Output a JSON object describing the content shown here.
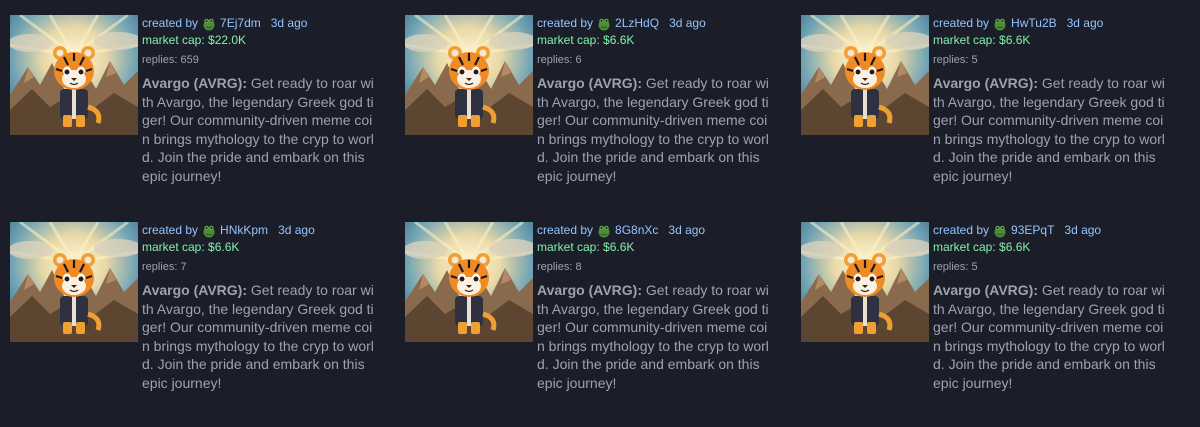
{
  "cards": [
    {
      "created_label": "created by",
      "creator": "7Ej7dm",
      "time": "3d ago",
      "market_cap": "market cap: $22.0K",
      "replies": "replies: 659",
      "token_name": "Avargo (AVRG):",
      "description": " Get ready to roar with Avargo, the legendary Greek god tiger! Our community-driven meme coin brings mythology to the cryp to world. Join the pride and embark on this epic journey!"
    },
    {
      "created_label": "created by",
      "creator": "2LzHdQ",
      "time": "3d ago",
      "market_cap": "market cap: $6.6K",
      "replies": "replies: 6",
      "token_name": "Avargo (AVRG):",
      "description": " Get ready to roar with Avargo, the legendary Greek god tiger! Our community-driven meme coin brings mythology to the cryp to world. Join the pride and embark on this epic journey!"
    },
    {
      "created_label": "created by",
      "creator": "HwTu2B",
      "time": "3d ago",
      "market_cap": "market cap: $6.6K",
      "replies": "replies: 5",
      "token_name": "Avargo (AVRG):",
      "description": " Get ready to roar with Avargo, the legendary Greek god tiger! Our community-driven meme coin brings mythology to the cryp to world. Join the pride and embark on this epic journey!"
    },
    {
      "created_label": "created by",
      "creator": "HNkKpm",
      "time": "3d ago",
      "market_cap": "market cap: $6.6K",
      "replies": "replies: 7",
      "token_name": "Avargo (AVRG):",
      "description": " Get ready to roar with Avargo, the legendary Greek god tiger! Our community-driven meme coin brings mythology to the cryp to world. Join the pride and embark on this epic journey!"
    },
    {
      "created_label": "created by",
      "creator": "8G8nXc",
      "time": "3d ago",
      "market_cap": "market cap: $6.6K",
      "replies": "replies: 8",
      "token_name": "Avargo (AVRG):",
      "description": " Get ready to roar with Avargo, the legendary Greek god tiger! Our community-driven meme coin brings mythology to the cryp to world. Join the pride and embark on this epic journey!"
    },
    {
      "created_label": "created by",
      "creator": "93EPqT",
      "time": "3d ago",
      "market_cap": "market cap: $6.6K",
      "replies": "replies: 5",
      "token_name": "Avargo (AVRG):",
      "description": " Get ready to roar with Avargo, the legendary Greek god tiger! Our community-driven meme coin brings mythology to the cryp to world. Join the pride and embark on this epic journey!"
    }
  ],
  "icons": {
    "creator_avatar": "frog-avatar-icon",
    "token_image": "tiger-token-image"
  },
  "colors": {
    "background": "#1b1d28",
    "link": "#93c5fd",
    "market_cap": "#86efac",
    "text": "#9ca3af"
  }
}
